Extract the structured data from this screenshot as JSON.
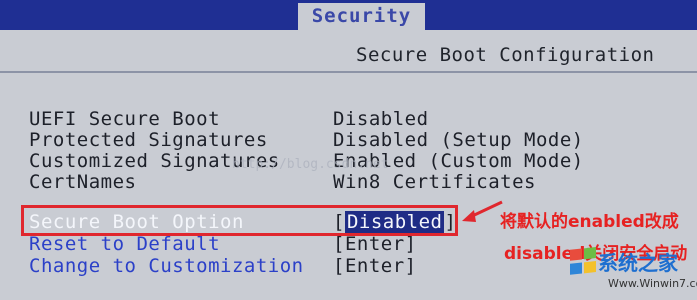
{
  "tab": "Security",
  "section_title": "Secure Boot Configuration",
  "settings": [
    {
      "label": "UEFI Secure Boot",
      "value": "Disabled"
    },
    {
      "label": "Protected Signatures",
      "value": "Disabled (Setup Mode)"
    },
    {
      "label": "Customized Signatures",
      "value": "Enabled (Custom Mode)"
    },
    {
      "label": "CertNames",
      "value": "Win8 Certificates"
    }
  ],
  "options": [
    {
      "label": "Secure Boot Option",
      "value_open": "[",
      "value": "Disabled",
      "value_close": "]"
    },
    {
      "label": "Reset to Default",
      "value": "[Enter]"
    },
    {
      "label": "Change to Customization",
      "value": "[Enter]"
    }
  ],
  "watermark_url": "http://blog.csdn.net",
  "annotation": {
    "line1": "将默认的enabled改成",
    "line2": "disabled关闭安全启动"
  },
  "logo": {
    "brand": "系统之家",
    "url": "Www.Winwin7.com"
  },
  "colors": {
    "header": "#1f2f93",
    "background": "#c9ccd3",
    "accent_blue": "#2b40c8",
    "annotation_red": "#e62222"
  }
}
